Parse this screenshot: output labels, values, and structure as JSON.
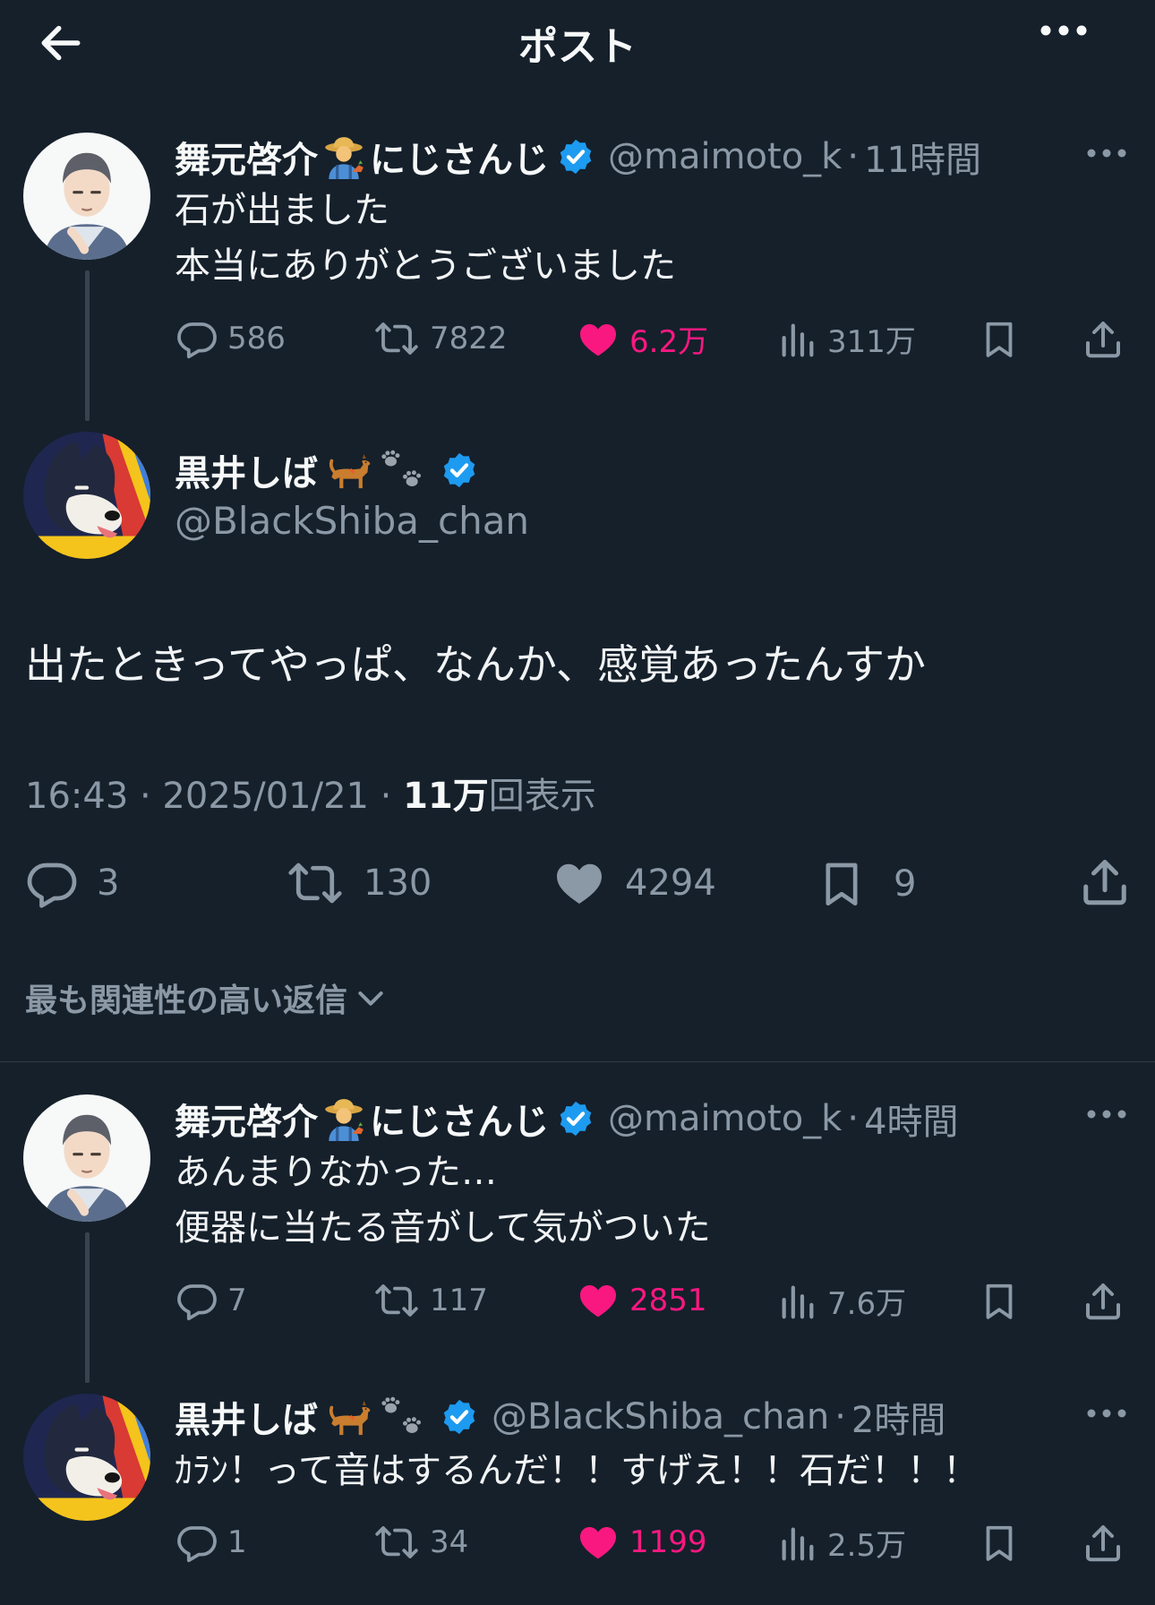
{
  "header": {
    "title": "ポスト"
  },
  "parent_post_1": {
    "name": "舞元啓介",
    "name_suffix": "にじさんじ",
    "handle": "@maimoto_k",
    "sep": "·",
    "time": "11時間",
    "lines": [
      "石が出ました",
      "本当にありがとうございました"
    ],
    "replies": "586",
    "reposts": "7822",
    "likes": "6.2万",
    "views": "311万"
  },
  "main_post": {
    "name": "黒井しば",
    "handle": "@BlackShiba_chan",
    "text": "出たときってやっぱ、なんか、感覚あったんすか",
    "timestamp": "16:43 · 2025/01/21 · ",
    "views_count": "11万",
    "views_label": "回表示",
    "replies": "3",
    "reposts": "130",
    "likes": "4294",
    "bookmarks": "9"
  },
  "sort": {
    "label": "最も関連性の高い返信"
  },
  "reply_1": {
    "name": "舞元啓介",
    "name_suffix": "にじさんじ",
    "handle": "@maimoto_k",
    "sep": "·",
    "time": "4時間",
    "lines": [
      "あんまりなかった…",
      "便器に当たる音がして気がついた"
    ],
    "replies": "7",
    "reposts": "117",
    "likes": "2851",
    "views": "7.6万"
  },
  "reply_2": {
    "name": "黒井しば",
    "handle": "@BlackShiba_chan",
    "sep": "·",
    "time": "2時間",
    "text": "ｶﾗﾝ！って音はするんだ！！すげえ！！石だ！！！",
    "replies": "1",
    "reposts": "34",
    "likes": "1199",
    "views": "2.5万"
  },
  "colors": {
    "background": "#15202b",
    "like": "#f91880",
    "verified": "#1d9bf0",
    "muted": "#8b98a5"
  },
  "icons": [
    "back-arrow-icon",
    "more-icon",
    "reply-icon",
    "repost-icon",
    "heart-icon",
    "views-icon",
    "bookmark-icon",
    "share-icon",
    "verified-icon",
    "farmer-emoji-icon",
    "dog-emoji-icon",
    "paw-prints-icon",
    "chevron-down-icon"
  ]
}
